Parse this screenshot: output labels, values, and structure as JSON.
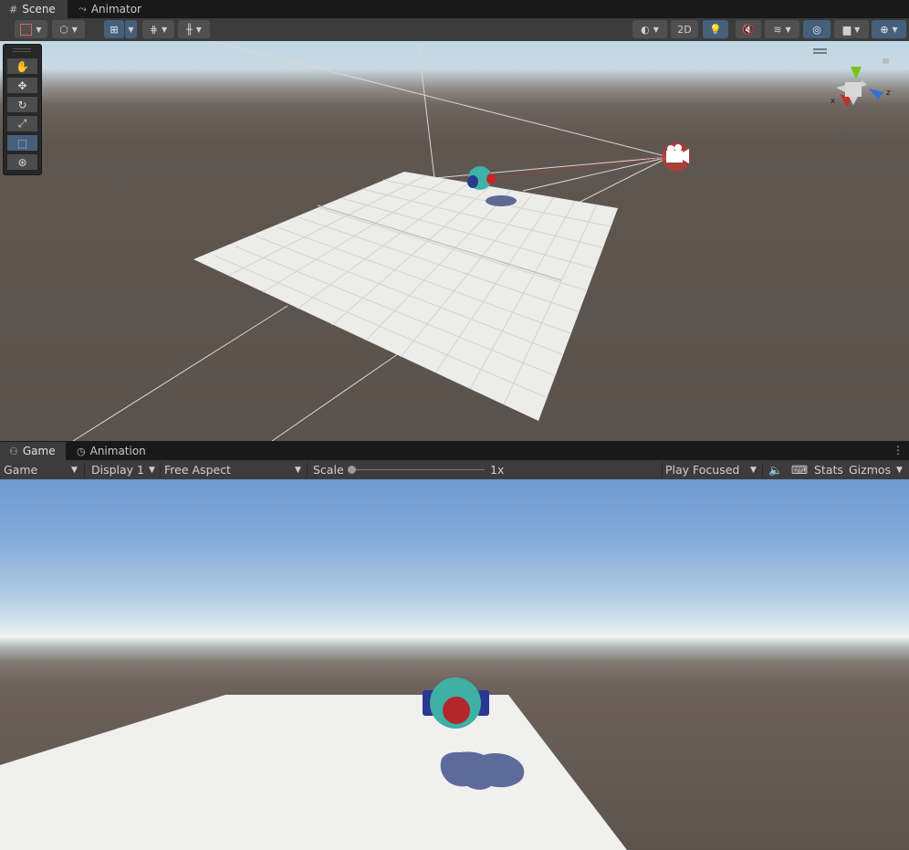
{
  "top_tabs": [
    {
      "label": "Scene",
      "icon": "grid-icon",
      "active": true
    },
    {
      "label": "Animator",
      "icon": "animator-icon",
      "active": false
    }
  ],
  "scene_toolbar": {
    "btn_2d": "2D",
    "accent": "#46607c"
  },
  "scene": {
    "persp_label": "Persp",
    "axis_x": "x",
    "axis_z": "z",
    "axis_y": "y"
  },
  "bottom_tabs": [
    {
      "label": "Game",
      "icon": "gamepad-icon",
      "active": true
    },
    {
      "label": "Animation",
      "icon": "clock-icon",
      "active": false
    }
  ],
  "game_toolbar": {
    "mode": "Game",
    "display": "Display 1",
    "aspect": "Free Aspect",
    "scale_label": "Scale",
    "scale_value": "1x",
    "scale_fraction": 0,
    "play_mode": "Play Focused",
    "stats": "Stats",
    "gizmos": "Gizmos"
  }
}
